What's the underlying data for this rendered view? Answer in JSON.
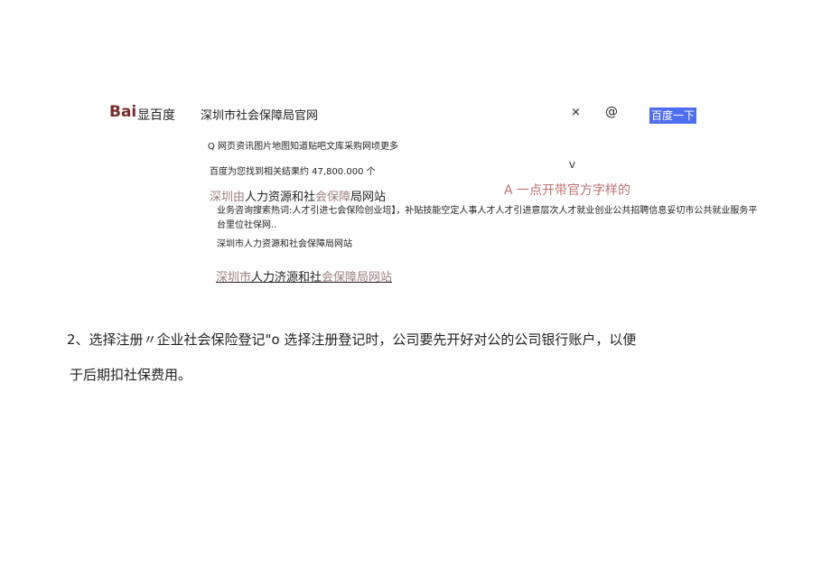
{
  "header": {
    "logo_bai": "Bai",
    "logo_du": "显百度",
    "search_value": "深圳市社会保障局官网",
    "clear_symbol": "×",
    "camera_symbol": "@",
    "search_button": "百度一下"
  },
  "tabs": [
    "Q 网页",
    "资讯",
    "图片",
    "地图",
    "知道",
    "贴吧",
    "文库",
    "采购",
    "网顷",
    "更多"
  ],
  "results_info": {
    "count_text": "百度为您找到相关结果约 47,800.000 个",
    "dropdown_symbol": "V"
  },
  "annotation": "A 一点开带官方字样的",
  "result1": {
    "title_gray_a": "深圳由",
    "title_black_a": "人力资源和社",
    "title_gray_b": "会保障",
    "title_black_b": "局网站",
    "snippet": "业务咨询搜索热词:人才引进七会保险创业培】，补贴技能空定人事人才人才引进意层次人才就业创业公共招聘信息妥切市公共就业服务平台里位社保网..",
    "url": "深圳市人力资源和社会保障局网站"
  },
  "result2": {
    "title_gray_a": "深圳市",
    "title_black_a": "人力济源和社",
    "title_gray_b": "会保障局网站"
  },
  "body_text": {
    "line1": "2、选择注册〃企业社会保险登记\"o 选择注册登记时，公司要先开好对公的公司银行账户，以便",
    "line2": "于后期扣社保费用。"
  }
}
